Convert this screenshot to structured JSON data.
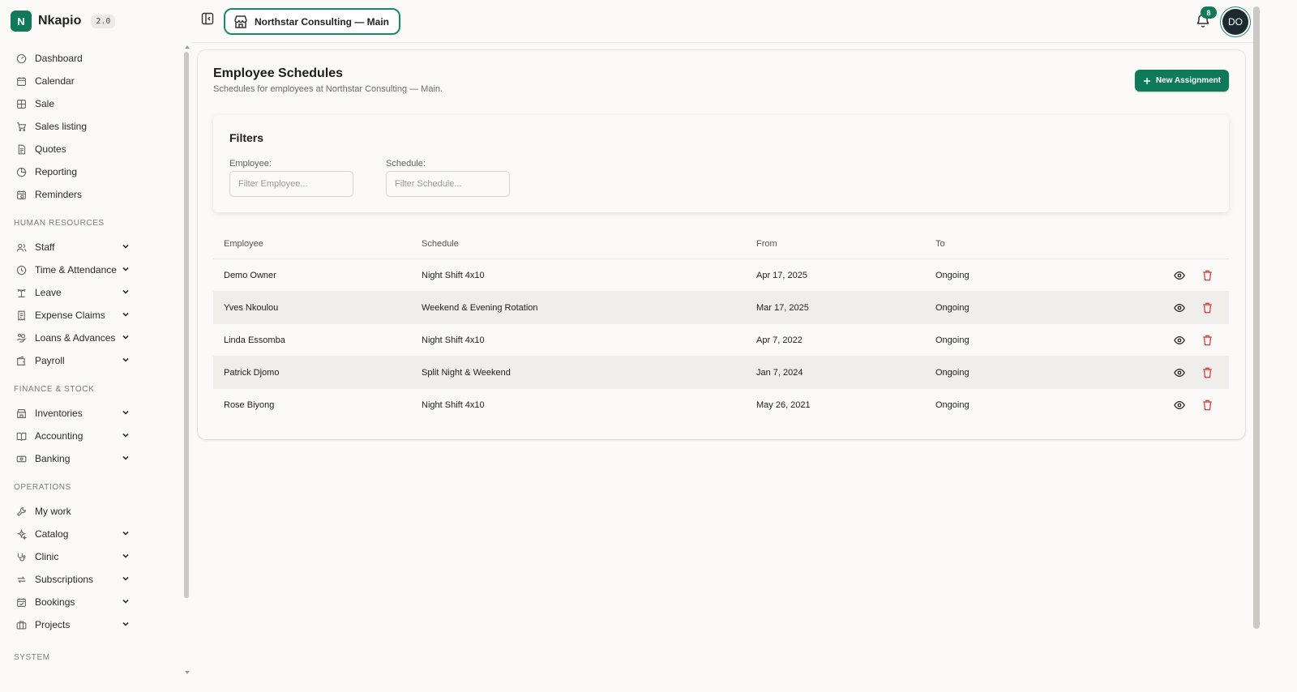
{
  "brand": {
    "logo_letter": "N",
    "name": "Nkapio",
    "version": "2.0"
  },
  "sidebar": {
    "top_items": [
      {
        "label": "Dashboard",
        "icon": "gauge-icon"
      },
      {
        "label": "Calendar",
        "icon": "calendar-icon"
      },
      {
        "label": "Sale",
        "icon": "grid-plus-icon"
      },
      {
        "label": "Sales listing",
        "icon": "cart-icon"
      },
      {
        "label": "Quotes",
        "icon": "document-icon"
      },
      {
        "label": "Reporting",
        "icon": "pie-chart-icon"
      },
      {
        "label": "Reminders",
        "icon": "calendar-clock-icon"
      }
    ],
    "sections": [
      {
        "title": "HUMAN RESOURCES",
        "items": [
          {
            "label": "Staff",
            "icon": "users-icon"
          },
          {
            "label": "Time & Attendance",
            "icon": "clock-icon"
          },
          {
            "label": "Leave",
            "icon": "palm-icon"
          },
          {
            "label": "Expense Claims",
            "icon": "receipt-icon"
          },
          {
            "label": "Loans & Advances",
            "icon": "hand-coins-icon"
          },
          {
            "label": "Payroll",
            "icon": "wallet-icon"
          }
        ]
      },
      {
        "title": "FINANCE & STOCK",
        "items": [
          {
            "label": "Inventories",
            "icon": "store-icon"
          },
          {
            "label": "Accounting",
            "icon": "book-icon"
          },
          {
            "label": "Banking",
            "icon": "banknote-icon"
          }
        ]
      },
      {
        "title": "OPERATIONS",
        "items": [
          {
            "label": "My work",
            "icon": "wrench-icon"
          },
          {
            "label": "Catalog",
            "icon": "sparkles-icon"
          },
          {
            "label": "Clinic",
            "icon": "stethoscope-icon"
          },
          {
            "label": "Subscriptions",
            "icon": "repeat-icon"
          },
          {
            "label": "Bookings",
            "icon": "calendar-check-icon"
          },
          {
            "label": "Projects",
            "icon": "briefcase-icon"
          }
        ]
      },
      {
        "title": "SYSTEM",
        "items": []
      }
    ]
  },
  "topbar": {
    "org_name": "Northstar Consulting — Main",
    "notification_count": "8",
    "avatar_initials": "DO"
  },
  "page": {
    "title": "Employee Schedules",
    "subtitle": "Schedules for employees at Northstar Consulting — Main.",
    "new_button": "New Assignment"
  },
  "filters": {
    "title": "Filters",
    "employee_label": "Employee:",
    "employee_placeholder": "Filter Employee...",
    "schedule_label": "Schedule:",
    "schedule_placeholder": "Filter Schedule..."
  },
  "table": {
    "headers": [
      "Employee",
      "Schedule",
      "From",
      "To"
    ],
    "rows": [
      {
        "employee": "Demo Owner",
        "schedule": "Night Shift 4x10",
        "from": "Apr 17, 2025",
        "to": "Ongoing"
      },
      {
        "employee": "Yves Nkoulou",
        "schedule": "Weekend & Evening Rotation",
        "from": "Mar 17, 2025",
        "to": "Ongoing"
      },
      {
        "employee": "Linda Essomba",
        "schedule": "Night Shift 4x10",
        "from": "Apr 7, 2022",
        "to": "Ongoing"
      },
      {
        "employee": "Patrick Djomo",
        "schedule": "Split Night & Weekend",
        "from": "Jan 7, 2024",
        "to": "Ongoing"
      },
      {
        "employee": "Rose Biyong",
        "schedule": "Night Shift 4x10",
        "from": "May 26, 2021",
        "to": "Ongoing"
      }
    ]
  },
  "colors": {
    "accent": "#0f7a5a",
    "danger": "#d64545",
    "background": "#fbfaf8"
  }
}
